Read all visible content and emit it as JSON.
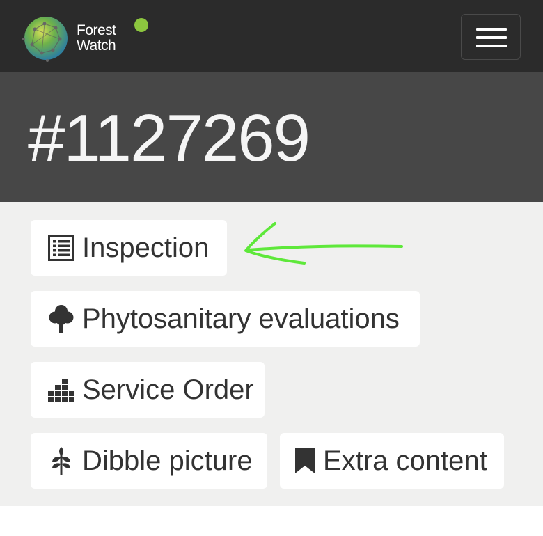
{
  "header": {
    "logo_line1": "Forest",
    "logo_line2": "Watch",
    "status_color": "#8cc63f",
    "menu_icon": "hamburger-menu-icon"
  },
  "banner": {
    "title": "#1127269"
  },
  "actions": [
    {
      "label": "Inspection",
      "icon": "list-icon"
    },
    {
      "label": "Phytosanitary evaluations",
      "icon": "tree-icon"
    },
    {
      "label": "Service Order",
      "icon": "stacked-blocks-icon"
    },
    {
      "label": "Dibble picture",
      "icon": "sprout-icon"
    },
    {
      "label": "Extra content",
      "icon": "bookmark-icon"
    }
  ],
  "annotation": {
    "arrow_color": "#5ee83a"
  }
}
